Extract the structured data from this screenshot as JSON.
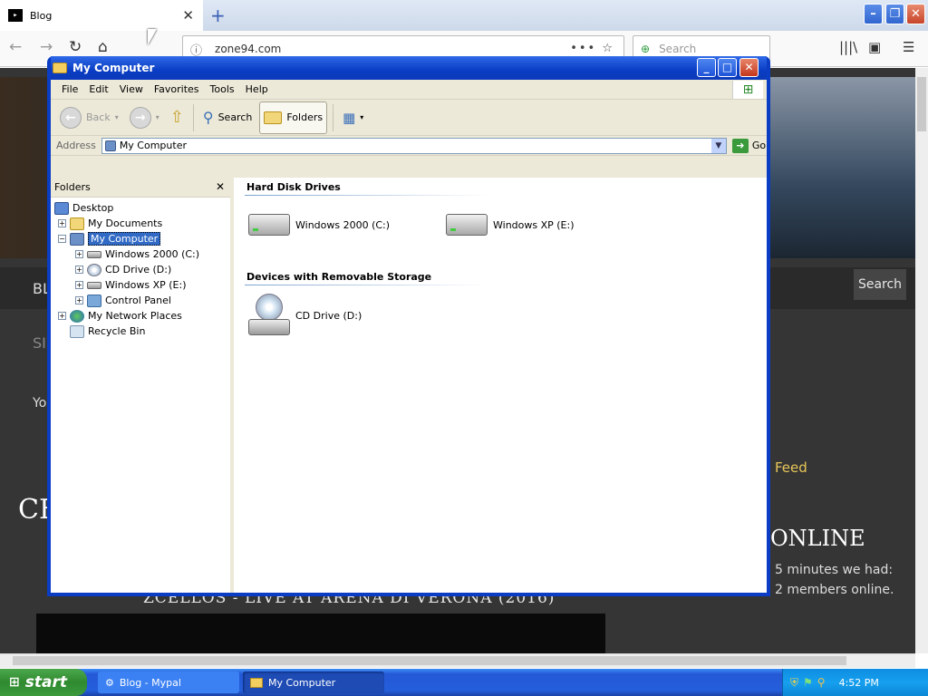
{
  "firefox": {
    "tab_title": "Blog",
    "favicon_text": "▸",
    "url": "zone94.com",
    "search_placeholder": "Search",
    "icons": {
      "back": "back-arrow-icon",
      "forward": "forward-arrow-icon",
      "reload": "reload-icon",
      "home": "home-icon",
      "more": "more-icon",
      "bookmark": "star-icon",
      "library": "library-icon",
      "sidebar": "sidebar-icon",
      "menu": "hamburger-icon"
    }
  },
  "page": {
    "search_label": "Search",
    "feed_label": "Feed",
    "online_title": "ONLINE",
    "online_line1": "5 minutes we had:",
    "online_line2": "2 members online.",
    "video_title": "ZCELLOS - LIVE AT ARENA DI VERONA (2016)",
    "partial_heading": "CE",
    "partial_bl": "BL",
    "partial_si": "SI",
    "partial_yo": "Yo"
  },
  "window": {
    "title": "My Computer",
    "menus": [
      "File",
      "Edit",
      "View",
      "Favorites",
      "Tools",
      "Help"
    ],
    "toolbar": {
      "back": "Back",
      "search": "Search",
      "folders": "Folders"
    },
    "address_label": "Address",
    "address_value": "My Computer",
    "go_label": "Go",
    "folders_header": "Folders",
    "tree": [
      {
        "label": "Desktop",
        "icon": "desktop-icon",
        "level": 0,
        "expander": ""
      },
      {
        "label": "My Documents",
        "icon": "my-documents-icon",
        "level": 1,
        "expander": "+"
      },
      {
        "label": "My Computer",
        "icon": "my-computer-icon",
        "level": 1,
        "expander": "−",
        "selected": true
      },
      {
        "label": "Windows 2000 (C:)",
        "icon": "hard-drive-icon",
        "level": 2,
        "expander": "+"
      },
      {
        "label": "CD Drive (D:)",
        "icon": "cd-drive-icon",
        "level": 2,
        "expander": "+"
      },
      {
        "label": "Windows XP (E:)",
        "icon": "hard-drive-icon",
        "level": 2,
        "expander": "+"
      },
      {
        "label": "Control Panel",
        "icon": "control-panel-icon",
        "level": 2,
        "expander": "+"
      },
      {
        "label": "My Network Places",
        "icon": "network-places-icon",
        "level": 1,
        "expander": "+"
      },
      {
        "label": "Recycle Bin",
        "icon": "recycle-bin-icon",
        "level": 1,
        "expander": ""
      }
    ],
    "groups": {
      "hard_disks": {
        "header": "Hard Disk Drives",
        "items": [
          "Windows 2000 (C:)",
          "Windows XP (E:)"
        ]
      },
      "removable": {
        "header": "Devices with Removable Storage",
        "items": [
          "CD Drive (D:)"
        ]
      }
    }
  },
  "taskbar": {
    "start_label": "start",
    "tasks": [
      "Blog - Mypal",
      "My Computer"
    ],
    "clock": "4:52 PM"
  },
  "colors": {
    "xp_title_blue": "#0a3dc4",
    "xp_start_green": "#3c993c",
    "selection_blue": "#316ac5"
  }
}
